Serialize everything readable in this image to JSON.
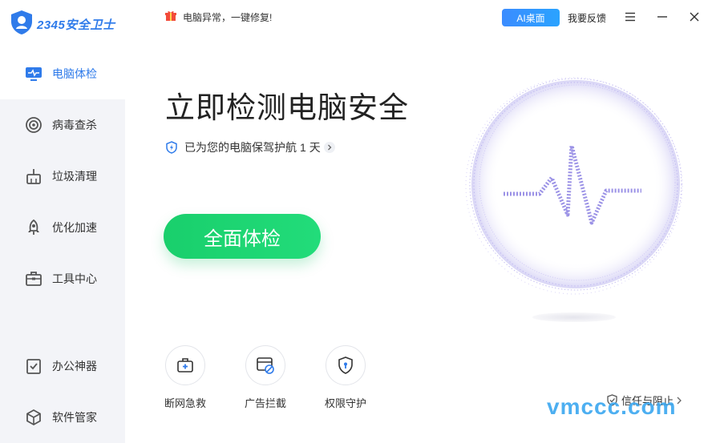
{
  "app": {
    "logo_text": "2345安全卫士"
  },
  "sidebar": {
    "items": [
      {
        "label": "电脑体检"
      },
      {
        "label": "病毒查杀"
      },
      {
        "label": "垃圾清理"
      },
      {
        "label": "优化加速"
      },
      {
        "label": "工具中心"
      },
      {
        "label": "办公神器"
      },
      {
        "label": "软件管家"
      }
    ]
  },
  "topbar": {
    "notice": "电脑异常，一键修复!",
    "ai_button": "AI桌面",
    "feedback": "我要反馈"
  },
  "main": {
    "title": "立即检测电脑安全",
    "protect_prefix": "已为您的电脑保驾护航",
    "protect_days": "1",
    "protect_suffix": "天",
    "scan_button": "全面体检"
  },
  "tools": [
    {
      "label": "断网急救"
    },
    {
      "label": "广告拦截"
    },
    {
      "label": "权限守护"
    }
  ],
  "trust_link": "信任与阻止",
  "watermark": "vmccc.com",
  "colors": {
    "accent": "#2f7bea",
    "green": "#1fd573",
    "sidebar_bg": "#f3f4f8"
  }
}
